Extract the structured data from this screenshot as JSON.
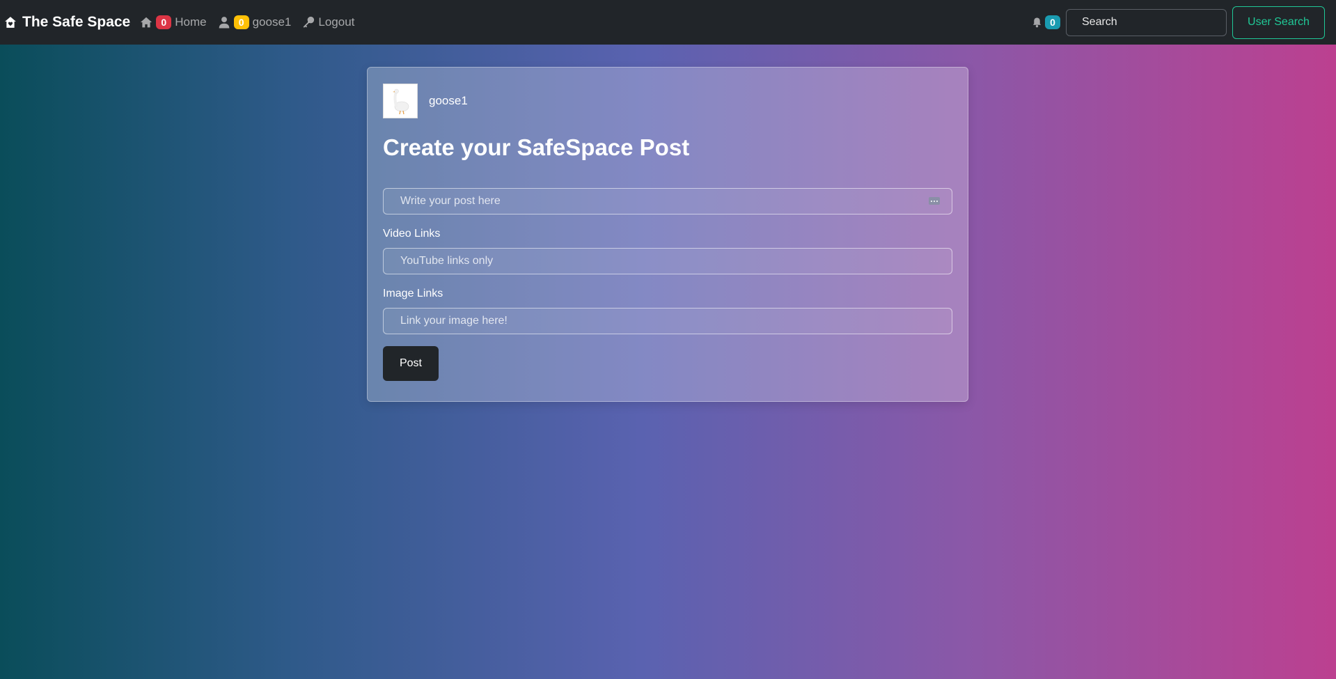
{
  "navbar": {
    "brand": "The Safe Space",
    "home_badge": "0",
    "home_label": "Home",
    "profile_badge": "0",
    "profile_label": "goose1",
    "logout_label": "Logout",
    "notifications_badge": "0",
    "search_placeholder": "Search",
    "user_search_label": "User Search"
  },
  "card": {
    "username": "goose1",
    "title": "Create your SafeSpace Post",
    "post_placeholder": "Write your post here",
    "video_label": "Video Links",
    "video_placeholder": "YouTube links only",
    "image_label": "Image Links",
    "image_placeholder": "Link your image here!",
    "post_button": "Post"
  },
  "colors": {
    "navbar_bg": "#212529",
    "badge_red": "#dc3545",
    "badge_yellow": "#ffc107",
    "badge_teal": "#1a9bb0",
    "accent_green": "#20c997"
  },
  "icons": {
    "brand": "house-heart-icon",
    "home": "home-icon",
    "profile": "user-icon",
    "logout": "key-icon",
    "notifications": "bell-icon",
    "post_field": "more-dots-icon"
  }
}
